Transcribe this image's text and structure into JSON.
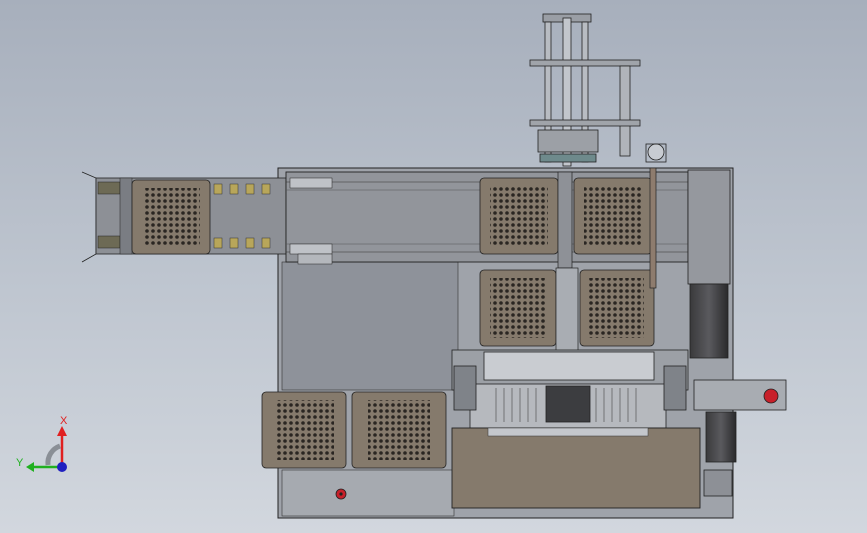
{
  "view": {
    "type": "CAD top view",
    "background_gradient": [
      "#a7afbc",
      "#d2d7de"
    ]
  },
  "triad": {
    "x_label": "X",
    "y_label": "Y",
    "x_color": "#e02020",
    "y_color": "#20b020",
    "z_color": "#2020c0"
  },
  "colors": {
    "tray_fill": "#857a6c",
    "tray_inner": "#6e655a",
    "frame": "#8f9298",
    "line": "#222222",
    "plate": "#a4a8ae",
    "estop": "#c8202a",
    "rail": "#7d8086"
  },
  "icons": {
    "emergency_stop": "estop-icon",
    "fan": "fan-icon"
  }
}
